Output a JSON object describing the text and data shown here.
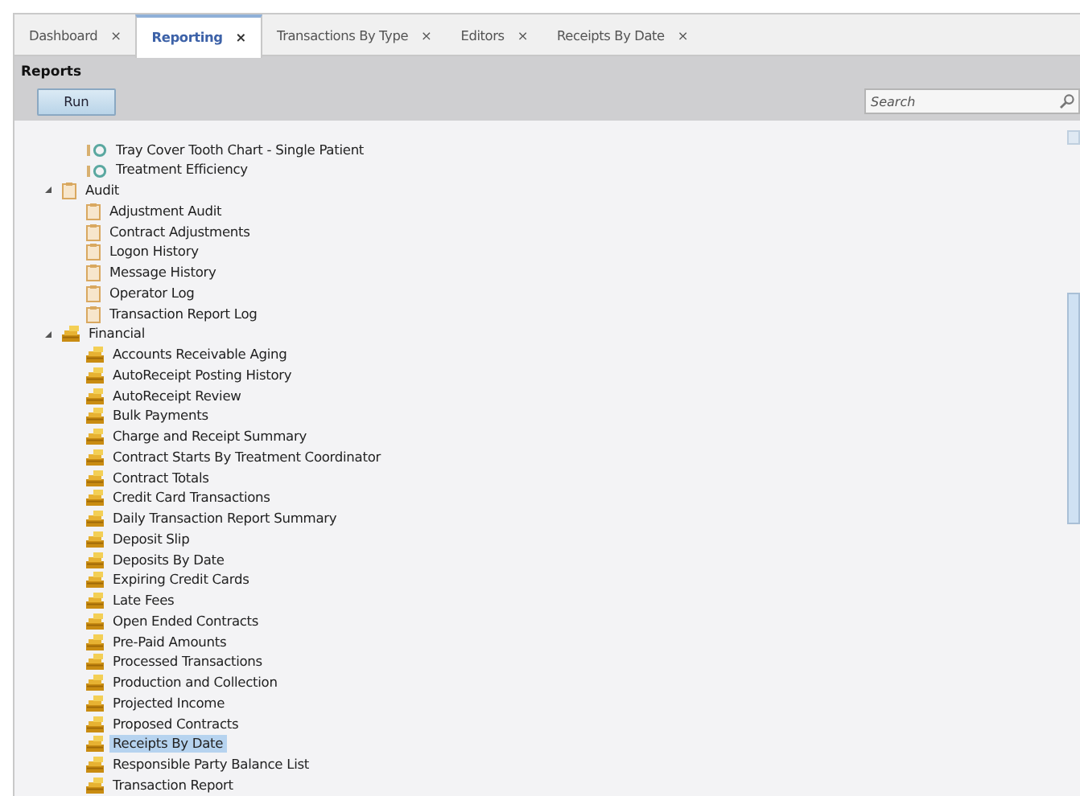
{
  "tabs": [
    {
      "label": "Dashboard",
      "close": "×",
      "selected": false
    },
    {
      "label": "Reporting",
      "close": "×",
      "selected": true
    },
    {
      "label": "Transactions By Type",
      "close": "×",
      "selected": false
    },
    {
      "label": "Editors",
      "close": "×",
      "selected": false
    },
    {
      "label": "Receipts By Date",
      "close": "×",
      "selected": false
    }
  ],
  "group_title": "Reports",
  "run_button": "Run",
  "search": {
    "placeholder": "Search"
  },
  "tree": [
    {
      "children": [
        {
          "label": "Tray Cover Tooth Chart - Single Patient",
          "kind": "chart",
          "selected": false
        },
        {
          "label": "Treatment Efficiency",
          "kind": "chart",
          "selected": false
        }
      ]
    },
    {
      "label": "Audit",
      "kind": "audit",
      "expanded": true,
      "selected": false,
      "children": [
        {
          "label": "Adjustment Audit",
          "kind": "audit",
          "selected": false
        },
        {
          "label": "Contract Adjustments",
          "kind": "audit",
          "selected": false
        },
        {
          "label": "Logon History",
          "kind": "audit",
          "selected": false
        },
        {
          "label": "Message History",
          "kind": "audit",
          "selected": false
        },
        {
          "label": "Operator Log",
          "kind": "audit",
          "selected": false
        },
        {
          "label": "Transaction Report Log",
          "kind": "audit",
          "selected": false
        }
      ]
    },
    {
      "label": "Financial",
      "kind": "financial",
      "expanded": true,
      "selected": false,
      "children": [
        {
          "label": "Accounts Receivable Aging",
          "kind": "financial",
          "selected": false
        },
        {
          "label": "AutoReceipt Posting History",
          "kind": "financial",
          "selected": false
        },
        {
          "label": "AutoReceipt Review",
          "kind": "financial",
          "selected": false
        },
        {
          "label": "Bulk Payments",
          "kind": "financial",
          "selected": false
        },
        {
          "label": "Charge and Receipt Summary",
          "kind": "financial",
          "selected": false
        },
        {
          "label": "Contract Starts By Treatment Coordinator",
          "kind": "financial",
          "selected": false
        },
        {
          "label": "Contract Totals",
          "kind": "financial",
          "selected": false
        },
        {
          "label": "Credit Card Transactions",
          "kind": "financial",
          "selected": false
        },
        {
          "label": "Daily Transaction Report Summary",
          "kind": "financial",
          "selected": false
        },
        {
          "label": "Deposit Slip",
          "kind": "financial",
          "selected": false
        },
        {
          "label": "Deposits By Date",
          "kind": "financial",
          "selected": false
        },
        {
          "label": "Expiring Credit Cards",
          "kind": "financial",
          "selected": false
        },
        {
          "label": "Late Fees",
          "kind": "financial",
          "selected": false
        },
        {
          "label": "Open Ended Contracts",
          "kind": "financial",
          "selected": false
        },
        {
          "label": "Pre-Paid Amounts",
          "kind": "financial",
          "selected": false
        },
        {
          "label": "Processed Transactions",
          "kind": "financial",
          "selected": false
        },
        {
          "label": "Production and Collection",
          "kind": "financial",
          "selected": false
        },
        {
          "label": "Projected Income",
          "kind": "financial",
          "selected": false
        },
        {
          "label": "Proposed Contracts",
          "kind": "financial",
          "selected": false
        },
        {
          "label": "Receipts By Date",
          "kind": "financial",
          "selected": true
        },
        {
          "label": "Responsible Party Balance List",
          "kind": "financial",
          "selected": false
        },
        {
          "label": "Transaction Report",
          "kind": "financial",
          "selected": false
        }
      ]
    }
  ]
}
